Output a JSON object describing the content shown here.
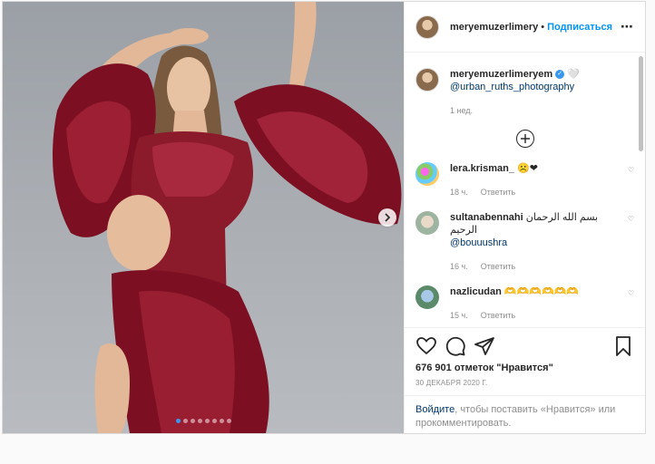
{
  "post": {
    "author": "meryemuzerlimery",
    "follow_label": "Подписаться",
    "separator": "•",
    "photo_dots_count": 8,
    "active_dot": 0
  },
  "caption": {
    "username": "meryemuzerlimeryem",
    "verified": "✓",
    "emoji": "🤍",
    "mention": "@urban_ruths_photography",
    "time": "1 нед."
  },
  "comments": [
    {
      "username": "lera.krisman_",
      "text": "☹️❤",
      "time": "18 ч.",
      "reply": "Ответить"
    },
    {
      "username": "sultanabennahi",
      "text": "بسم الله الرحمان الرحيم",
      "mention": "@bouuushra",
      "time": "16 ч.",
      "reply": "Ответить"
    },
    {
      "username": "nazlicudan",
      "text": "🫶🫶🫶🫶🫶🫶",
      "time": "15 ч.",
      "reply": "Ответить"
    }
  ],
  "actions": {
    "likes": "676 901 отметок \"Нравится\"",
    "date": "30 ДЕКАБРЯ 2020 Г."
  },
  "login": {
    "link": "Войдите",
    "rest": ", чтобы поставить «Нравится» или прокомментировать."
  },
  "colors": {
    "accent": "#0095f6",
    "dress": "#8b1a2b",
    "text": "#262626",
    "muted": "#8e8e8e"
  }
}
